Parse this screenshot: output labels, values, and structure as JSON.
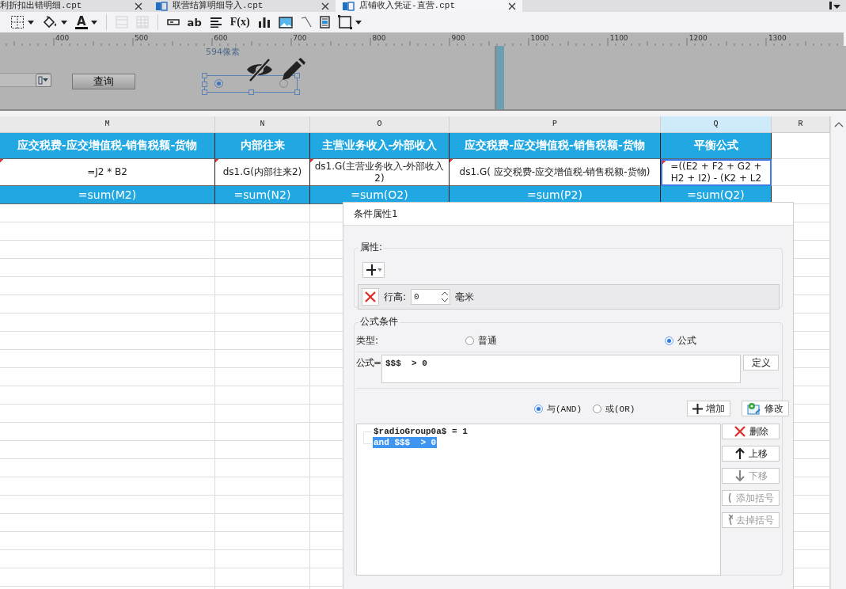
{
  "tabs": [
    {
      "label": "利折扣出错明细.cpt",
      "selected": false,
      "icon": false
    },
    {
      "label": "联营结算明细导入.cpt",
      "selected": false,
      "icon": true
    },
    {
      "label": "店铺收入凭证-直营.cpt",
      "selected": true,
      "icon": true
    }
  ],
  "toolbar": [
    {
      "kind": "borders",
      "disabled": false
    },
    {
      "kind": "fill",
      "disabled": false
    },
    {
      "kind": "font-color",
      "label": "A",
      "disabled": false
    },
    {
      "kind": "separator"
    },
    {
      "kind": "merge",
      "disabled": true
    },
    {
      "kind": "unmerge",
      "disabled": true
    },
    {
      "kind": "separator"
    },
    {
      "kind": "text-field",
      "disabled": false
    },
    {
      "kind": "text",
      "label": "ab",
      "disabled": false
    },
    {
      "kind": "align",
      "disabled": false
    },
    {
      "kind": "formula",
      "label": "F(x)",
      "disabled": false
    },
    {
      "kind": "chart",
      "disabled": false
    },
    {
      "kind": "image",
      "disabled": false
    },
    {
      "kind": "slash",
      "disabled": false
    },
    {
      "kind": "subreport",
      "disabled": false
    },
    {
      "kind": "border-box",
      "disabled": false
    }
  ],
  "ruler": {
    "labels": [
      "400",
      "500",
      "600",
      "700",
      "800",
      "900",
      "1000",
      "1100",
      "1200",
      "1300"
    ]
  },
  "parameter_panel": {
    "size_hint": "594像素",
    "query_button": "查询",
    "radio_widget": [
      {
        "selected": true
      },
      {
        "selected": false
      }
    ]
  },
  "sheet": {
    "columns": [
      {
        "label": "M",
        "selected": false
      },
      {
        "label": "N",
        "selected": false
      },
      {
        "label": "O",
        "selected": false
      },
      {
        "label": "P",
        "selected": false
      },
      {
        "label": "Q",
        "selected": true
      },
      {
        "label": "R",
        "selected": false
      }
    ],
    "rows": [
      {
        "kind": "header",
        "cells": [
          {
            "text": "应交税费-应交增值税-销售税额-货物",
            "selected": false
          },
          {
            "text": "内部往来",
            "selected": false
          },
          {
            "text": "主营业务收入-外部收入",
            "selected": false
          },
          {
            "text": "应交税费-应交增值税-销售税额-货物",
            "selected": false
          },
          {
            "text": "平衡公式",
            "selected": false
          }
        ]
      },
      {
        "kind": "formula",
        "cells": [
          {
            "text": "=J2 * B2",
            "selected": false
          },
          {
            "text": "ds1.G(内部往来2)",
            "selected": false
          },
          {
            "text": "ds1.G(主营业务收入-外部收入2)",
            "selected": false
          },
          {
            "text": "ds1.G( 应交税费-应交增值税-销售税额-货物)",
            "selected": false
          },
          {
            "text": "=((E2 + F2 + G2 + H2 + I2) - (K2 + L2",
            "selected": true
          }
        ]
      },
      {
        "kind": "sum",
        "cells": [
          {
            "text": "=sum(M2)",
            "selected": false
          },
          {
            "text": "=sum(N2)",
            "selected": false
          },
          {
            "text": "=sum(O2)",
            "selected": false
          },
          {
            "text": "=sum(P2)",
            "selected": false
          },
          {
            "text": "=sum(Q2)",
            "selected": false
          }
        ]
      }
    ]
  },
  "dialog": {
    "title": "条件属性1",
    "attributes": {
      "legend": "属性:",
      "row_label": "行高:",
      "row_value": "0",
      "row_unit": "毫米"
    },
    "formula_condition": {
      "legend": "公式条件",
      "type_label": "类型:",
      "types": [
        {
          "label": "普通",
          "selected": false
        },
        {
          "label": "公式",
          "selected": true
        }
      ],
      "formula_label": "公式=",
      "formula": "$$$  > 0",
      "define_button": "定义",
      "logic": [
        {
          "label": "与(AND)",
          "selected": true
        },
        {
          "label": "或(OR)",
          "selected": false
        }
      ],
      "add_button": "增加",
      "edit_button": "修改",
      "conditions": [
        {
          "text": "$radioGroup0a$ = 1",
          "selected": false
        },
        {
          "text": "and $$$  > 0",
          "selected": true
        }
      ],
      "side_buttons": [
        {
          "kind": "delete",
          "label": "删除",
          "disabled": false
        },
        {
          "kind": "up",
          "label": "上移",
          "disabled": false
        },
        {
          "kind": "down",
          "label": "下移",
          "disabled": true
        },
        {
          "kind": "add-paren",
          "label": "添加括号",
          "disabled": true
        },
        {
          "kind": "remove-paren",
          "label": "去掉括号",
          "disabled": true
        }
      ]
    }
  }
}
